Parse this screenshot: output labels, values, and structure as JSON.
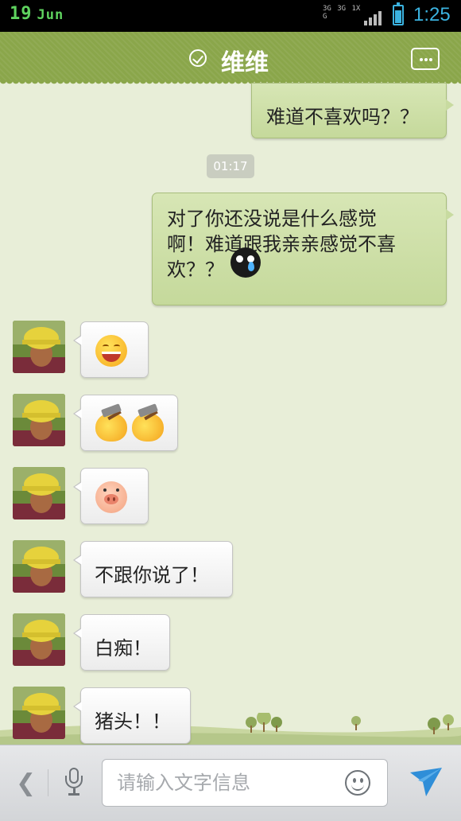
{
  "status_bar": {
    "day": "19",
    "month": "Jun",
    "network": "3G 3G 1X G",
    "time": "1:25"
  },
  "header": {
    "contact_name": "维维"
  },
  "messages": [
    {
      "side": "out",
      "text": "难道不喜欢吗？？"
    },
    {
      "side": "out",
      "text_line1": "对了你还没说是什么感觉",
      "text_line2": "啊！难道跟我亲亲感觉不喜",
      "text_line3": "欢？？",
      "emoji": "sweat-face-icon"
    },
    {
      "side": "in",
      "emoji": "grin-icon"
    },
    {
      "side": "in",
      "emoji": "hammer-icon"
    },
    {
      "side": "in",
      "emoji": "pig-icon"
    },
    {
      "side": "in",
      "text": "不跟你说了！"
    },
    {
      "side": "in",
      "text": "白痴！"
    },
    {
      "side": "in",
      "text": "猪头！！"
    }
  ],
  "timestamp": "01:17",
  "input_bar": {
    "placeholder": "请输入文字信息"
  },
  "colors": {
    "header": "#8aa64a",
    "out_bubble": "#cfe0a8",
    "background": "#e8eed8",
    "send": "#2f8ed8"
  }
}
